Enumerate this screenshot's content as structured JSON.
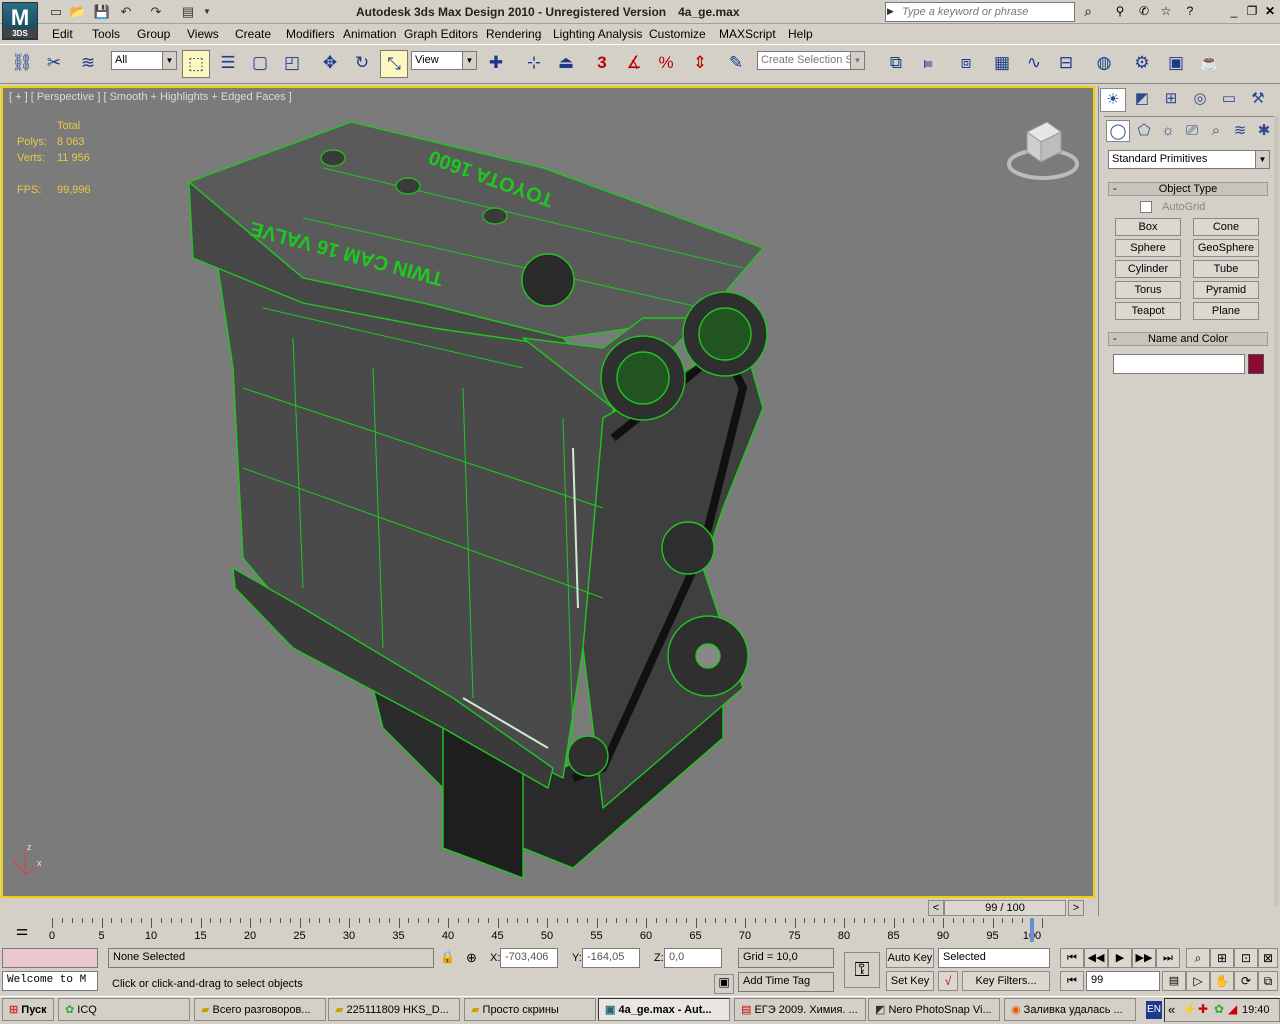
{
  "app": {
    "title": "Autodesk 3ds Max Design 2010",
    "version_note": "- Unregistered Version",
    "file": "4a_ge.max",
    "logo_label": "3DS",
    "search_placeholder": "Type a keyword or phrase"
  },
  "menu": [
    "Edit",
    "Tools",
    "Group",
    "Views",
    "Create",
    "Modifiers",
    "Animation",
    "Graph Editors",
    "Rendering",
    "Lighting Analysis",
    "Customize",
    "MAXScript",
    "Help"
  ],
  "toolbar": {
    "filter_value": "All",
    "coord_system": "View",
    "snap_value": "3",
    "selection_set_placeholder": "Create Selection Se"
  },
  "viewport": {
    "label": "[ + ] [ Perspective ] [ Smooth + Highlights + Edged Faces ]",
    "stats_header": "Total",
    "polys_label": "Polys:",
    "polys_value": "8 063",
    "verts_label": "Verts:",
    "verts_value": "11 956",
    "fps_label": "FPS:",
    "fps_value": "99,996",
    "engine_text_1": "TOYOTA 1600",
    "engine_text_2": "TWIN CAM 16 VALVE",
    "axis_z": "z",
    "axis_x": "x"
  },
  "command_panel": {
    "category": "Standard Primitives",
    "object_type_title": "Object Type",
    "autogrid_label": "AutoGrid",
    "buttons": [
      "Box",
      "Cone",
      "Sphere",
      "GeoSphere",
      "Cylinder",
      "Tube",
      "Torus",
      "Pyramid",
      "Teapot",
      "Plane"
    ],
    "name_color_title": "Name and Color",
    "name_value": "",
    "color": "#8b0a32",
    "collapse_symbol": "-"
  },
  "timeline": {
    "frame_display": "99 / 100",
    "current_frame": 99,
    "total_frames": 100,
    "prev_arrow": "<",
    "next_arrow": ">",
    "tick_labels": [
      "0",
      "5",
      "10",
      "15",
      "20",
      "25",
      "30",
      "35",
      "40",
      "45",
      "50",
      "55",
      "60",
      "65",
      "70",
      "75",
      "80",
      "85",
      "90",
      "95",
      "100"
    ]
  },
  "status": {
    "maxscript_text": "Welcome to M",
    "selection_text": "None Selected",
    "prompt_text": "Click or click-and-drag to select objects",
    "x_label": "X:",
    "x_value": "-703,406",
    "y_label": "Y:",
    "y_value": "-164,05",
    "z_label": "Z:",
    "z_value": "0,0",
    "grid_text": "Grid = 10,0",
    "add_time_tag": "Add Time Tag",
    "auto_key": "Auto Key",
    "set_key": "Set Key",
    "key_mode_value": "Selected",
    "key_filters": "Key Filters...",
    "frame_spinner": "99"
  },
  "taskbar": {
    "start_label": "Пуск",
    "items": [
      {
        "label": "ICQ",
        "active": false
      },
      {
        "label": "Всего разговоров...",
        "active": false
      },
      {
        "label": "225111809 HKS_D...",
        "active": false
      },
      {
        "label": "Просто скрины",
        "active": false
      },
      {
        "label": "4a_ge.max - Aut...",
        "active": true
      },
      {
        "label": "ЕГЭ 2009. Химия. ...",
        "active": false
      },
      {
        "label": "Nero PhotoSnap Vi...",
        "active": false
      },
      {
        "label": "Заливка удалась ...",
        "active": false
      }
    ],
    "lang": "EN",
    "tray_arrow": "«",
    "clock": "19:40"
  },
  "colors": {
    "viewport_bg": "#7b7b7b",
    "viewport_border": "#f0d000",
    "stats_text": "#e8c84a",
    "wire_green": "#1ec81e"
  }
}
